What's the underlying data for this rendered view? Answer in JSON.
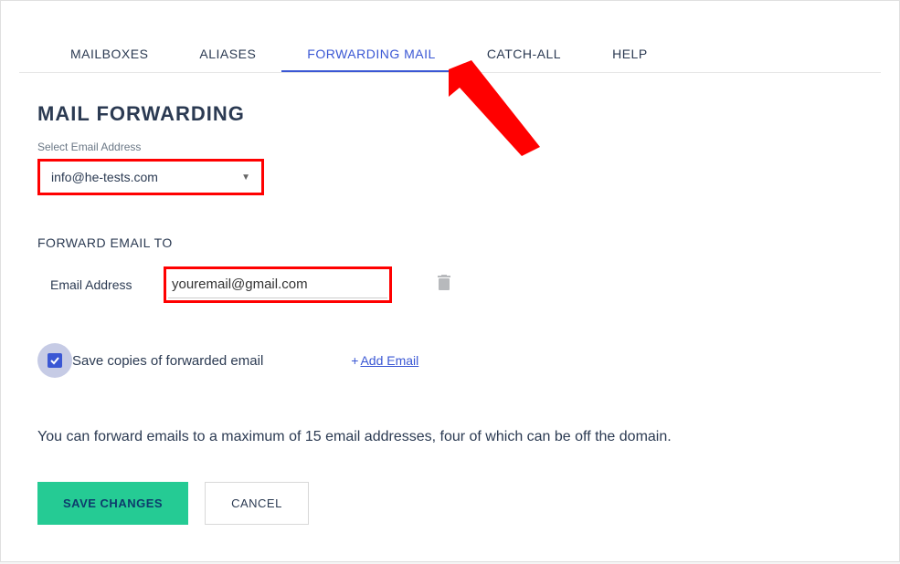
{
  "tabs": {
    "mailboxes": "MAILBOXES",
    "aliases": "ALIASES",
    "forwarding": "FORWARDING MAIL",
    "catchall": "CATCH-ALL",
    "help": "HELP"
  },
  "page": {
    "title": "MAIL FORWARDING"
  },
  "select": {
    "label": "Select Email Address",
    "value": "info@he-tests.com"
  },
  "forward": {
    "section_label": "FORWARD EMAIL TO",
    "field_label": "Email Address",
    "value": "youremail@gmail.com"
  },
  "checkbox": {
    "label": "Save copies of forwarded email",
    "checked": true
  },
  "add_email": {
    "plus": "+",
    "label": "Add Email"
  },
  "help_text": "You can forward emails to a maximum of 15 email addresses, four of which can be off the domain.",
  "buttons": {
    "save": "SAVE CHANGES",
    "cancel": "CANCEL"
  }
}
